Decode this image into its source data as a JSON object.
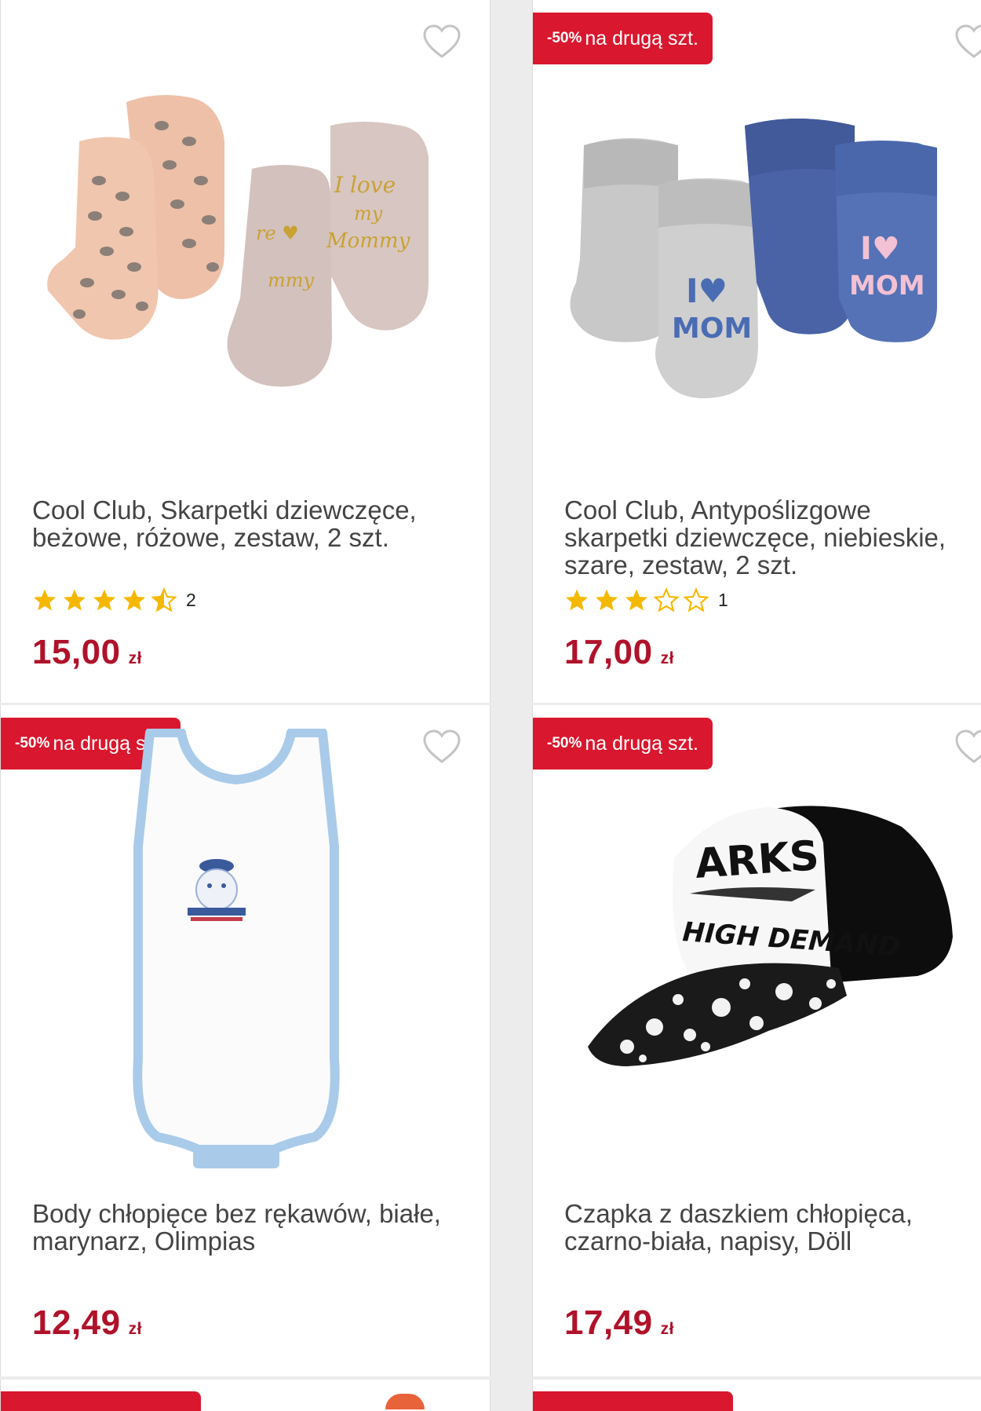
{
  "currency": "zł",
  "badge": {
    "pct": "-50%",
    "text": "na drugą szt."
  },
  "products": [
    {
      "name": "Cool Club, Skarpetki dziewczęce, beżowe, różowe, zestaw, 2 szt.",
      "rating": 4.5,
      "reviews": "2",
      "price": "15,00",
      "badge": false,
      "image": "socks-leopard-pink-image"
    },
    {
      "name": "Cool Club, Antypoślizgowe skarpetki dziewczęce, niebieskie, szare, zestaw, 2 szt.",
      "rating": 3,
      "reviews": "1",
      "price": "17,00",
      "badge": true,
      "image": "socks-grey-blue-mom-image"
    },
    {
      "name": "Body chłopięce bez rękawów, białe, marynarz, Olimpias",
      "price": "12,49",
      "badge": true,
      "image": "sailor-bodysuit-image"
    },
    {
      "name": "Czapka z daszkiem chłopięca, czarno-biała, napisy, Döll",
      "price": "17,49",
      "badge": true,
      "image": "sharks-baseball-cap-image"
    }
  ],
  "colors": {
    "accent": "#d9172e",
    "price": "#b0122a",
    "star": "#f5b800"
  }
}
